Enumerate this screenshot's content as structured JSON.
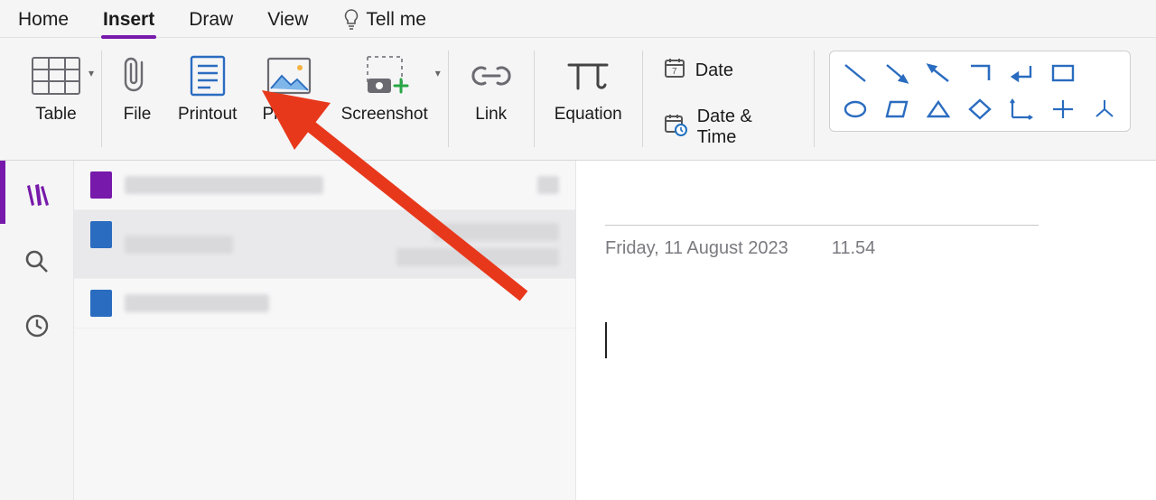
{
  "tabs": {
    "home": "Home",
    "insert": "Insert",
    "draw": "Draw",
    "view": "View",
    "tellme": "Tell me"
  },
  "ribbon": {
    "table": "Table",
    "file": "File",
    "printout": "Printout",
    "picture": "Picture",
    "screenshot": "Screenshot",
    "link": "Link",
    "equation": "Equation",
    "date": "Date",
    "datetime": "Date & Time"
  },
  "note": {
    "date": "Friday, 11 August 2023",
    "time": "11.54"
  },
  "colors": {
    "accent": "#7719AA",
    "shape": "#2A6CC0",
    "arrow": "#E8381C"
  }
}
